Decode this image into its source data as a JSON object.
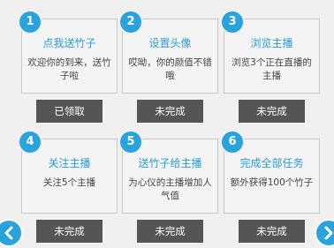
{
  "tasks": [
    {
      "num": "1",
      "title": "点我送竹子",
      "desc": "欢迎你的到来，送竹子啦",
      "status": "已领取"
    },
    {
      "num": "2",
      "title": "设置头像",
      "desc": "哎呦，你的颜值不错哦",
      "status": "未完成"
    },
    {
      "num": "3",
      "title": "浏览主播",
      "desc": "浏览3个正在直播的主播",
      "status": "未完成"
    },
    {
      "num": "4",
      "title": "关注主播",
      "desc": "关注5个主播",
      "status": "未完成"
    },
    {
      "num": "5",
      "title": "送竹子给主播",
      "desc": "为心仪的主播增加人气值",
      "status": "未完成"
    },
    {
      "num": "6",
      "title": "完成全部任务",
      "desc": "额外获得100个竹子",
      "status": "未完成"
    }
  ],
  "colors": {
    "accent": "#29a3dc",
    "button": "#555555",
    "card_border": "#c9c9c9"
  },
  "icons": {
    "prev": "chevron-left-icon",
    "next": "chevron-right-icon"
  }
}
